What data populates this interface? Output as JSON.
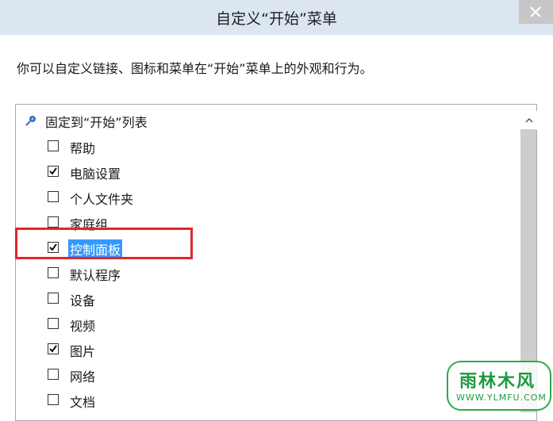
{
  "window": {
    "title": "自定义“开始”菜单"
  },
  "description": "你可以自定义链接、图标和菜单在“开始”菜单上的外观和行为。",
  "list": {
    "group_label": "固定到“开始”列表",
    "items": [
      {
        "label": "帮助",
        "checked": false
      },
      {
        "label": "电脑设置",
        "checked": true
      },
      {
        "label": "个人文件夹",
        "checked": false
      },
      {
        "label": "家庭组",
        "checked": false
      },
      {
        "label": "控制面板",
        "checked": true,
        "selected": true
      },
      {
        "label": "默认程序",
        "checked": false
      },
      {
        "label": "设备",
        "checked": false
      },
      {
        "label": "视频",
        "checked": false
      },
      {
        "label": "图片",
        "checked": true
      },
      {
        "label": "网络",
        "checked": false
      },
      {
        "label": "文档",
        "checked": false
      }
    ]
  },
  "icons": {
    "close": "close-icon",
    "pin": "pin-icon",
    "scroll_up": "chevron-up-icon",
    "check": "checkmark-icon"
  },
  "colors": {
    "titlebar": "#dbe6f1",
    "selection": "#3399ff",
    "highlight_box": "#e0262f",
    "watermark": "#1c9a3e"
  },
  "watermark": {
    "logo_text": "雨林木风",
    "url_text": "WWW.YLMFU.COM"
  }
}
